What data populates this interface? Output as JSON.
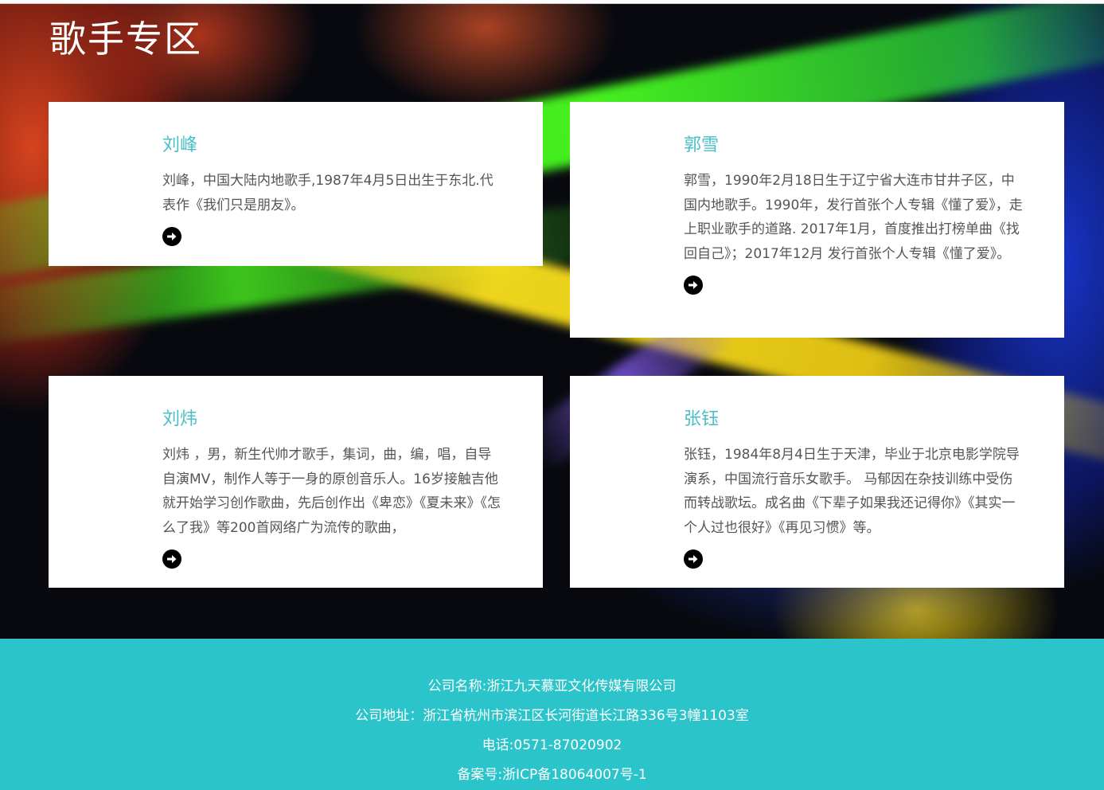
{
  "page": {
    "title": "歌手专区"
  },
  "singers": [
    {
      "name": "刘峰",
      "description": "刘峰，中国大陆内地歌手,1987年4月5日出生于东北.代表作《我们只是朋友》。",
      "more_icon": "arrow-circle-right-icon"
    },
    {
      "name": "郭雪",
      "description": "郭雪，1990年2月18日生于辽宁省大连市甘井子区，中国内地歌手。1990年，发行首张个人专辑《懂了爱》，走上职业歌手的道路. 2017年1月，首度推出打榜单曲《找回自己》；2017年12月 发行首张个人专辑《懂了爱》。",
      "more_icon": "arrow-circle-right-icon"
    },
    {
      "name": "刘炜",
      "description": "刘炜 ，男，新生代帅才歌手，集词，曲，编，唱，自导自演MV，制作人等于一身的原创音乐人。16岁接触吉他就开始学习创作歌曲，先后创作出《卑恋》《夏未来》《怎么了我》等200首网络广为流传的歌曲，",
      "more_icon": "arrow-circle-right-icon"
    },
    {
      "name": "张钰",
      "description": "张钰，1984年8月4日生于天津，毕业于北京电影学院导演系，中国流行音乐女歌手。 马郁因在杂技训练中受伤而转战歌坛。成名曲《下辈子如果我还记得你》《其实一个人过也很好》《再见习惯》等。",
      "more_icon": "arrow-circle-right-icon"
    }
  ],
  "footer": {
    "company": "公司名称:浙江九天慕亚文化传媒有限公司",
    "address": "公司地址：浙江省杭州市滨江区长河街道长江路336号3幢1103室",
    "phone": "电话:0571-87020902",
    "icp": "备案号:浙ICP备18064007号-1"
  },
  "colors": {
    "accent": "#49bfc7",
    "footer_bg": "#2ac4ca",
    "text": "#555555"
  }
}
